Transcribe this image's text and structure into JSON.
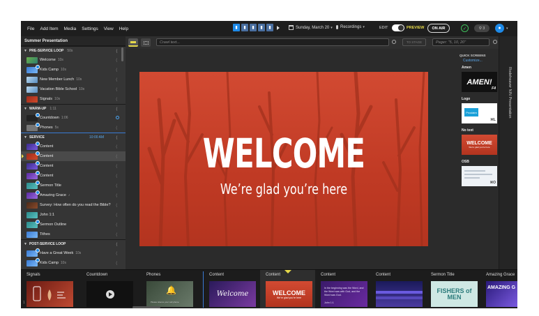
{
  "menubar": {
    "items": [
      "File",
      "Add Item",
      "Media",
      "Settings",
      "View",
      "Help"
    ],
    "date": "Sunday, March 20",
    "recordings": "Recordings",
    "edit": "EDIT",
    "preview": "PREVIEW",
    "on_air": "ON AIR",
    "notifications": "3"
  },
  "sidebar": {
    "presentation_title": "Summer Presentation",
    "sections": [
      {
        "name": "PRE-SERVICE LOOP",
        "duration": "50s",
        "items": [
          {
            "label": "Welcome",
            "duration": "10s"
          },
          {
            "label": "Kids Camp",
            "duration": "10s"
          },
          {
            "label": "New Member Lunch",
            "duration": "10s"
          },
          {
            "label": "Vacation Bible School",
            "duration": "10s"
          },
          {
            "label": "Signals",
            "duration": "10s"
          }
        ]
      },
      {
        "name": "WARM-UP",
        "duration": "1:11",
        "items": [
          {
            "label": "Countdown",
            "duration": "1:06"
          },
          {
            "label": "Phones",
            "duration": "5s"
          }
        ]
      },
      {
        "name": "SERVICE",
        "time": "10:00 AM",
        "items": [
          {
            "label": "Content",
            "duration": ""
          },
          {
            "label": "Content",
            "duration": ""
          },
          {
            "label": "Content",
            "duration": ""
          },
          {
            "label": "Content",
            "duration": ""
          },
          {
            "label": "Sermon Title",
            "duration": ""
          },
          {
            "label": "Amazing Grace",
            "duration": "♪"
          },
          {
            "label": "Survey: How often do you read the Bible?",
            "duration": ""
          },
          {
            "label": "John 1:1",
            "duration": ""
          },
          {
            "label": "Sermon Outline",
            "duration": ""
          },
          {
            "label": "Tithes",
            "duration": ""
          }
        ]
      },
      {
        "name": "POST-SERVICE LOOP",
        "duration": "",
        "items": [
          {
            "label": "Have a Great Week",
            "duration": "10s"
          },
          {
            "label": "Kids Camp",
            "duration": "10s"
          }
        ]
      }
    ]
  },
  "stage_bar": {
    "crawl_placeholder": "Crawl text...",
    "to_stage": "TO STAGE",
    "pager_placeholder": "Pager: \"5, 10, 20\""
  },
  "slide": {
    "title": "WELCOME",
    "subtitle": "We’re glad you’re here"
  },
  "quick_screens": {
    "title": "QUICK SCREENS",
    "customize": "Customize...",
    "items": [
      {
        "label": "Amen",
        "thumb_text": "AMEN!",
        "key": "F4"
      },
      {
        "label": "Logo",
        "thumb_text": "Proclaim",
        "key": "⌘L"
      },
      {
        "label": "No text",
        "thumb_text": "WELCOME",
        "thumb_sub": "We’re glad you’re here",
        "key": ""
      },
      {
        "label": "OSB",
        "thumb_text": "",
        "key": "⌘O"
      }
    ]
  },
  "side_tab": {
    "label": "Rodeheaver NIN Presentation"
  },
  "strip": {
    "cells": [
      {
        "label": "Signals"
      },
      {
        "label": "Countdown"
      },
      {
        "label": "Phones",
        "thumb_text": "Please silence your cell phone"
      },
      {
        "label": "Content",
        "thumb_text": "Welcome"
      },
      {
        "label": "Content",
        "thumb_text": "WELCOME",
        "thumb_sub": "We’re glad you’re here"
      },
      {
        "label": "Content",
        "thumb_text": "In the beginning was the Word, and the Word was with God, and the Word was God.",
        "thumb_ref": "John 1:1"
      },
      {
        "label": "Content"
      },
      {
        "label": "Sermon Title",
        "thumb_text": "FISHERS of MEN"
      },
      {
        "label": "Amazing Grace",
        "thumb_text": "AMAZING G"
      }
    ],
    "page_num": "1"
  },
  "colors": {
    "accent": "#1e8ae8",
    "preview": "#e6d94a",
    "slide_red": "#c03a24",
    "on_air_ok": "#3fbf5a"
  }
}
